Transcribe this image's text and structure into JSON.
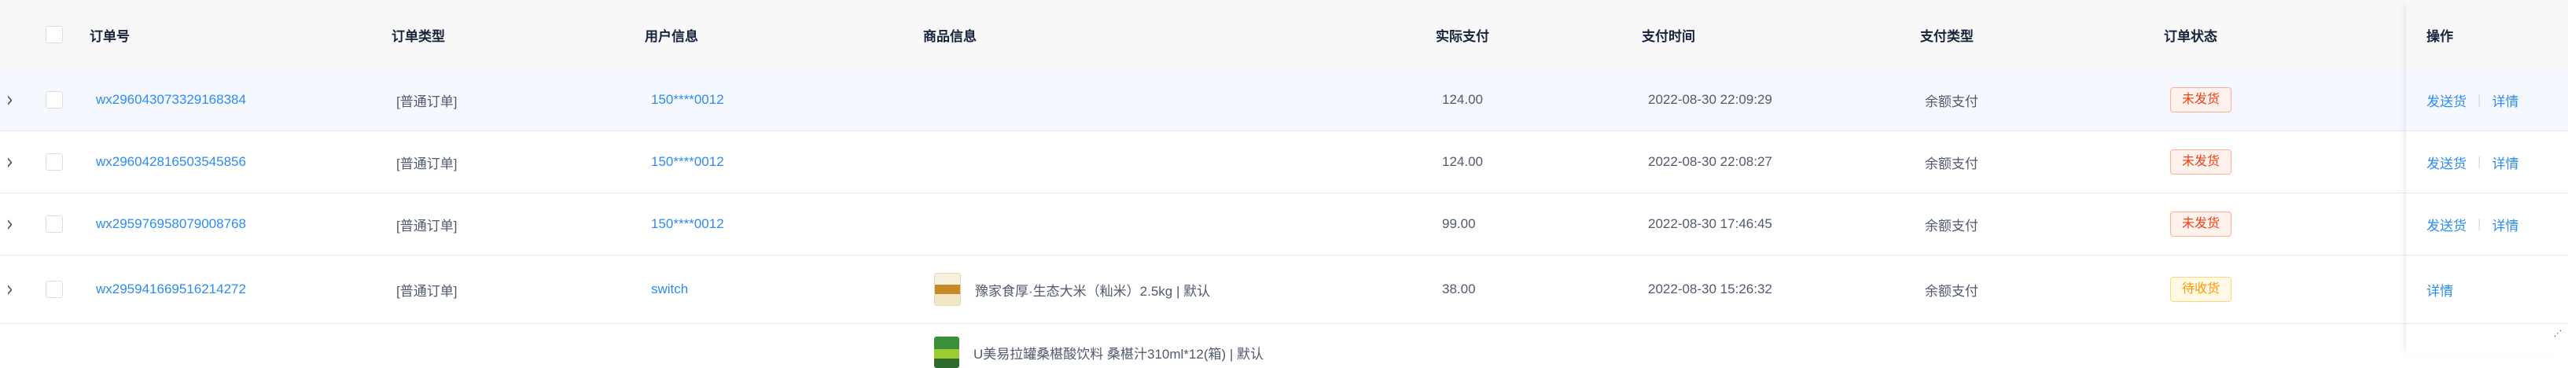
{
  "header": {
    "order_no": "订单号",
    "order_type": "订单类型",
    "user_info": "用户信息",
    "product_info": "商品信息",
    "actual_paid": "实际支付",
    "pay_time": "支付时间",
    "pay_type": "支付类型",
    "order_status": "订单状态",
    "actions": "操作"
  },
  "rows": [
    {
      "order_no": "wx296043073329168384",
      "order_type": "[普通订单]",
      "user": "150****0012",
      "product": "",
      "amount": "124.00",
      "pay_time": "2022-08-30 22:09:29",
      "pay_type": "余额支付",
      "status": "未发货",
      "action_ship": "发送货",
      "action_detail": "详情"
    },
    {
      "order_no": "wx296042816503545856",
      "order_type": "[普通订单]",
      "user": "150****0012",
      "product": "",
      "amount": "124.00",
      "pay_time": "2022-08-30 22:08:27",
      "pay_type": "余额支付",
      "status": "未发货",
      "action_ship": "发送货",
      "action_detail": "详情"
    },
    {
      "order_no": "wx295976958079008768",
      "order_type": "[普通订单]",
      "user": "150****0012",
      "product": "",
      "amount": "99.00",
      "pay_time": "2022-08-30 17:46:45",
      "pay_type": "余额支付",
      "status": "未发货",
      "action_ship": "发送货",
      "action_detail": "详情"
    },
    {
      "order_no": "wx295941669516214272",
      "order_type": "[普通订单]",
      "user": "switch",
      "product": "豫家食厚·生态大米（籼米）2.5kg | 默认",
      "amount": "38.00",
      "pay_time": "2022-08-30 15:26:32",
      "pay_type": "余额支付",
      "status": "待收货",
      "action_detail": "详情"
    }
  ],
  "partial_row": {
    "product": "U美易拉罐桑椹酸饮料 桑椹汁310ml*12(箱) | 默认"
  },
  "colors": {
    "link": "#2d8cf0",
    "status_unshipped": "#ed4014",
    "status_pending_receipt": "#ff9900",
    "header_bg": "#f8f8f9"
  },
  "icons": {
    "expand": "chevron-right-icon",
    "checkbox": "checkbox-icon"
  }
}
